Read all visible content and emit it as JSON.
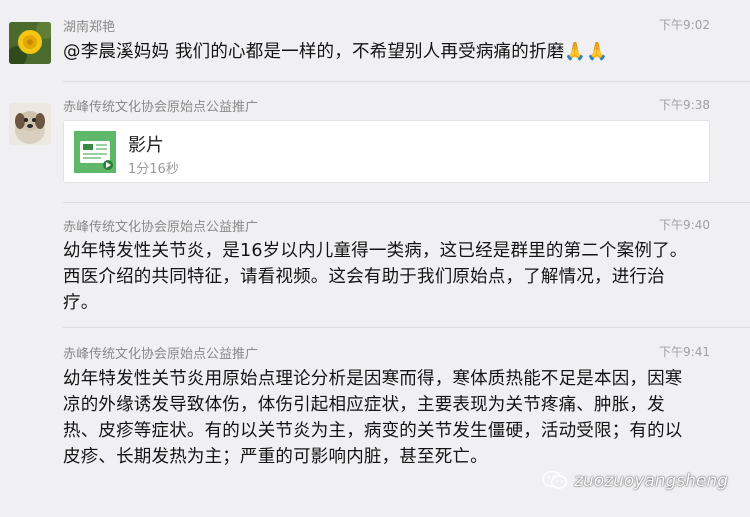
{
  "messages": [
    {
      "sender": "湖南郑艳",
      "time": "下午9:02",
      "text": "@李晨溪妈妈 我们的心都是一样的，不希望别人再受病痛的折磨🙏🙏"
    },
    {
      "sender": "赤峰传统文化协会原始点公益推广",
      "time": "下午9:38",
      "card": {
        "title": "影片",
        "subtitle": "1分16秒"
      }
    },
    {
      "sender": "赤峰传统文化协会原始点公益推广",
      "time": "下午9:40",
      "text": "幼年特发性关节炎，是16岁以内儿童得一类病，这已经是群里的第二个案例了。西医介绍的共同特征，请看视频。这会有助于我们原始点，了解情况，进行治疗。"
    },
    {
      "sender": "赤峰传统文化协会原始点公益推广",
      "time": "下午9:41",
      "text": "幼年特发性关节炎用原始点理论分析是因寒而得，寒体质热能不足是本因，因寒凉的外缘诱发导致体伤，体伤引起相应症状，主要表现为关节疼痛、肿胀，发热、皮疹等症状。有的以关节炎为主，病变的关节发生僵硬，活动受限；有的以皮疹、长期发热为主；严重的可影响内脏，甚至死亡。"
    }
  ],
  "watermark": {
    "text": "zuozuoyangsheng",
    "icon": "wechat-icon"
  }
}
